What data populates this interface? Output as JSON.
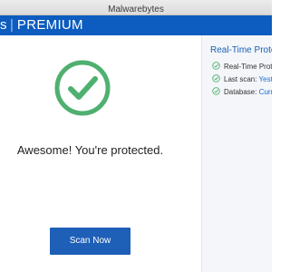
{
  "window": {
    "title": "Malwarebytes"
  },
  "header": {
    "logo_mark": "s",
    "edition": "PREMIUM"
  },
  "main": {
    "status_text": "Awesome! You're protected.",
    "scan_button_label": "Scan Now"
  },
  "side": {
    "title": "Real-Time Protec",
    "rows": [
      {
        "label": "Real-Time Prote",
        "value": ""
      },
      {
        "label": "Last scan: ",
        "value": "Yest"
      },
      {
        "label": "Database: ",
        "value": "Curr"
      }
    ]
  },
  "colors": {
    "brand_blue": "#0d5cbf",
    "button_blue": "#1e5fb8",
    "success_green": "#4fb06f"
  },
  "icons": [
    "shield-check-icon",
    "check-circle-icon"
  ]
}
